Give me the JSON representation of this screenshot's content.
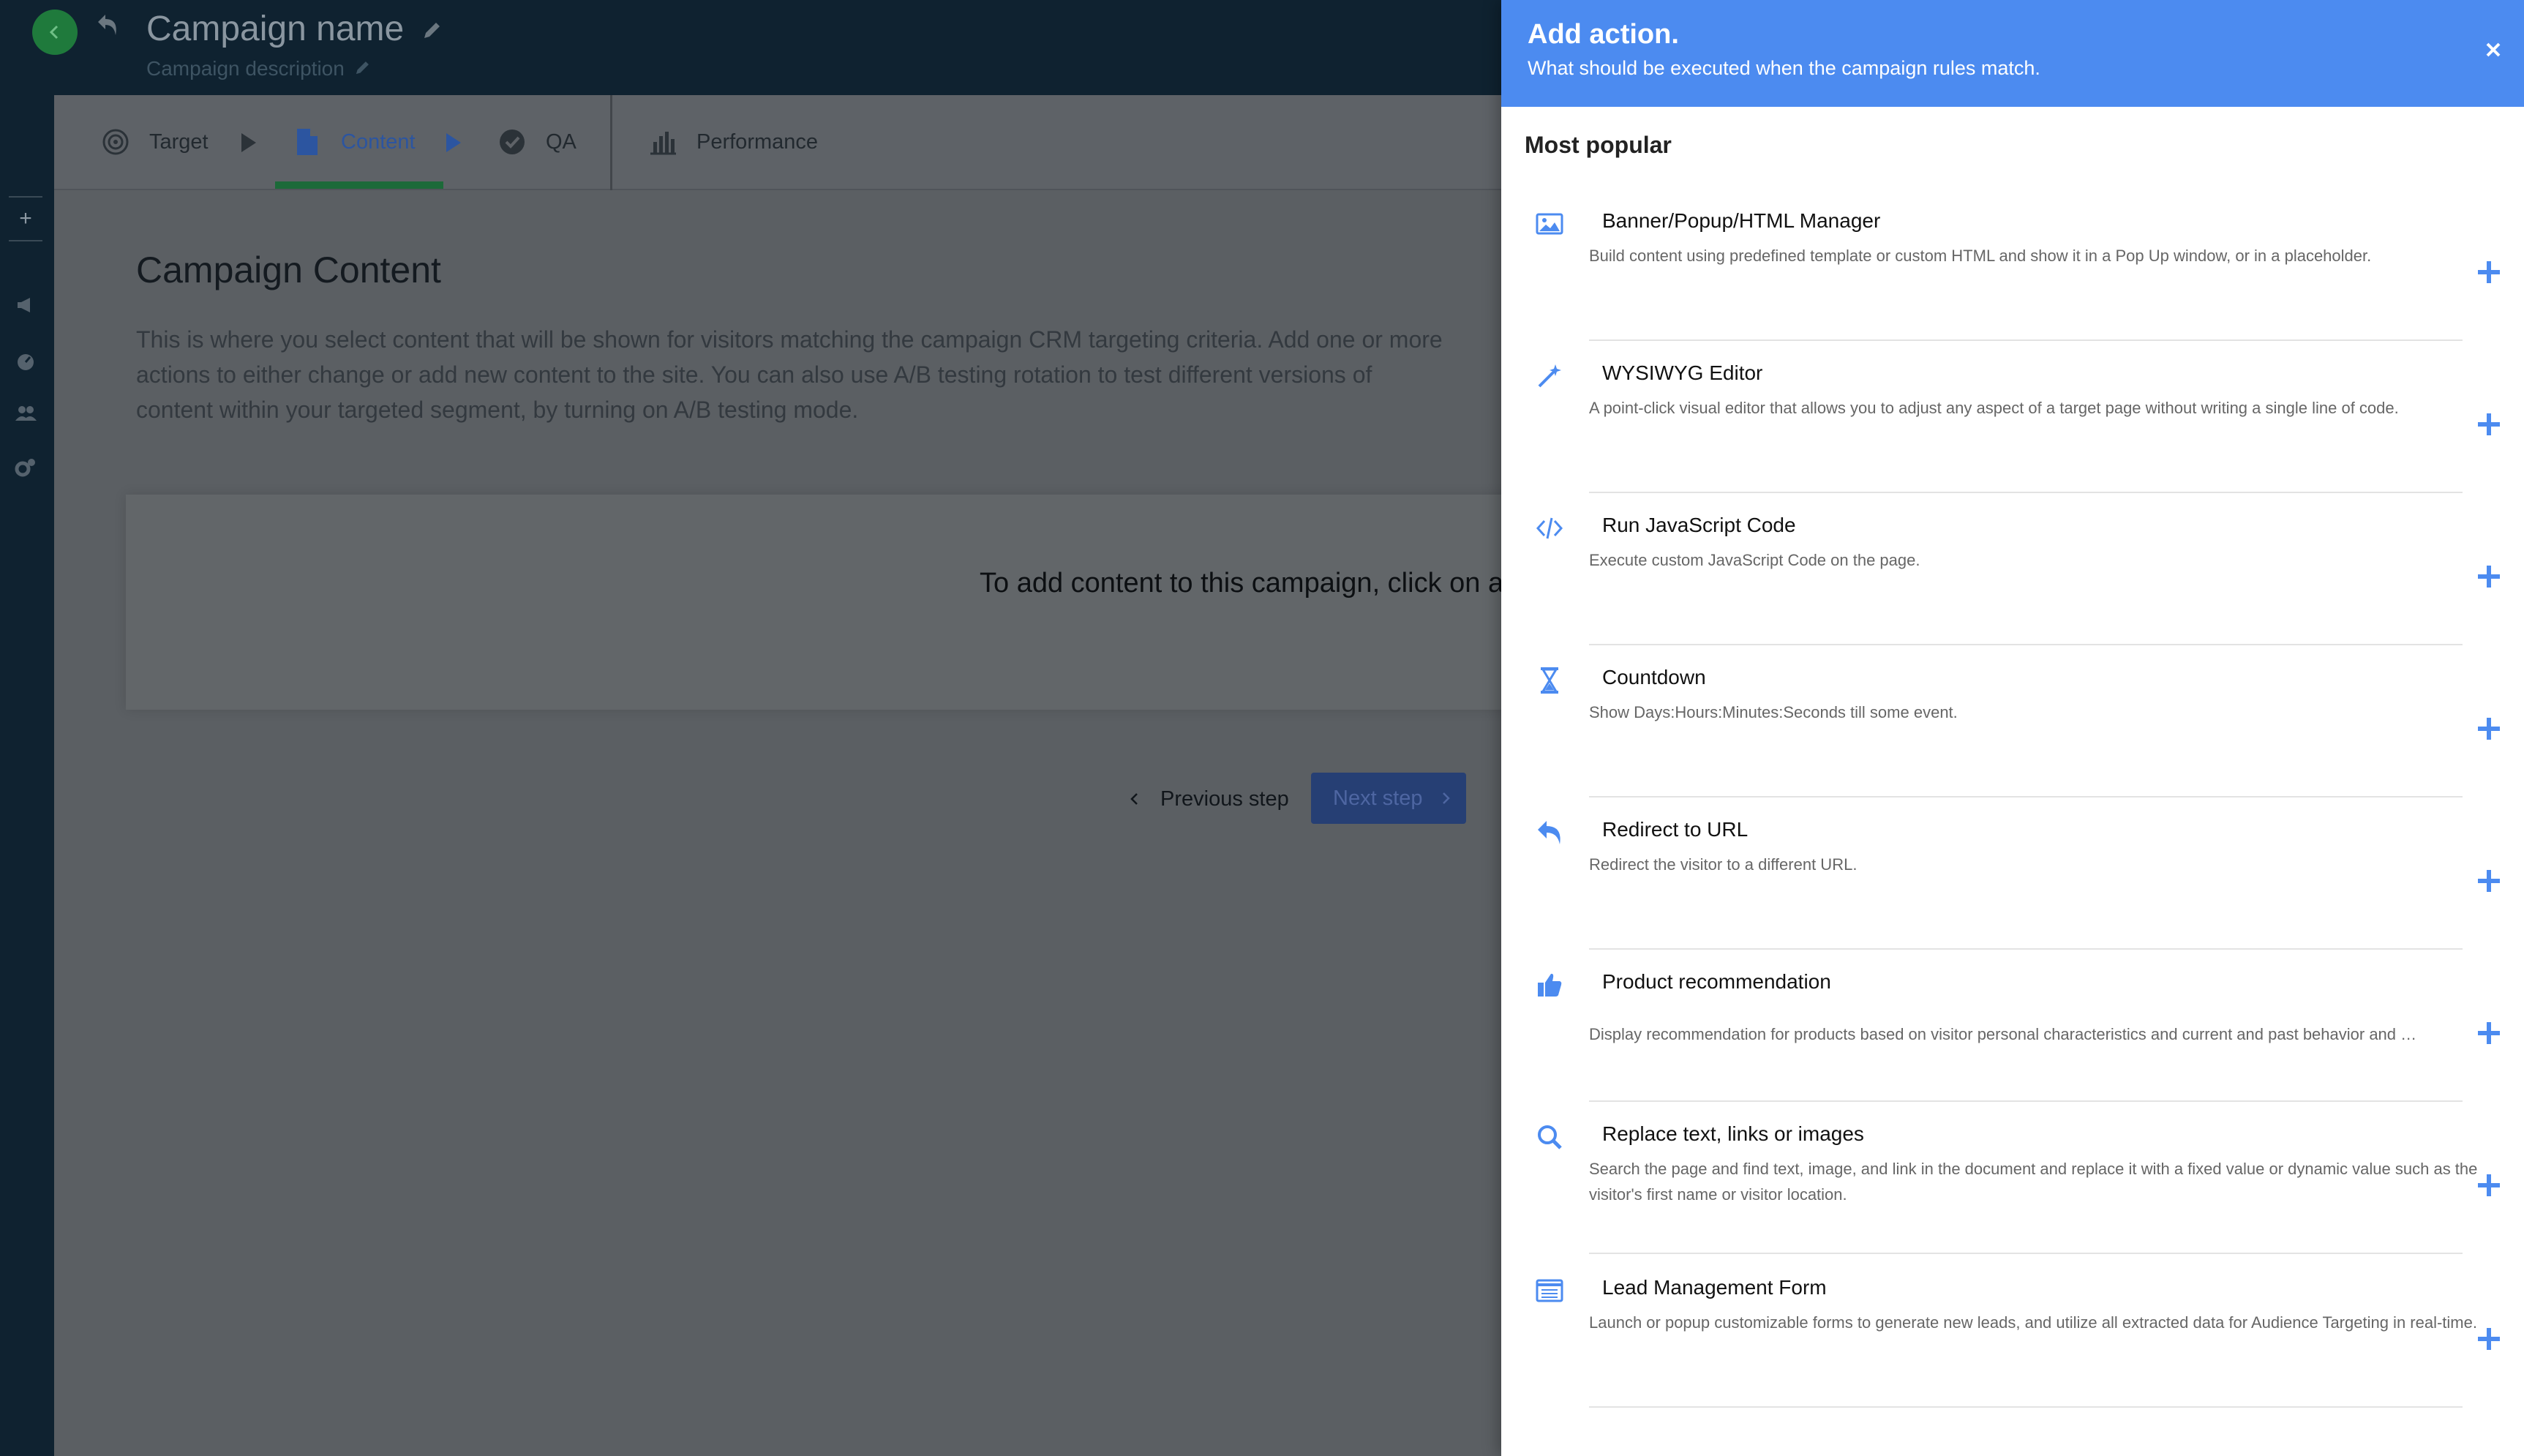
{
  "colors": {
    "accent_blue": "#4c8bf0",
    "rail_dark": "#0f2230",
    "green_indicator": "#1c6a39",
    "overlay_gray": "#5b5f63"
  },
  "header": {
    "campaign_name": "Campaign name",
    "campaign_description": "Campaign description"
  },
  "tabs": [
    {
      "label": "Target",
      "icon": "target-icon"
    },
    {
      "label": "Content",
      "icon": "document-icon",
      "active": true
    },
    {
      "label": "QA",
      "icon": "check-circle-icon"
    },
    {
      "label": "Performance",
      "icon": "bar-chart-icon"
    }
  ],
  "main": {
    "heading": "Campaign Content",
    "paragraph": "This is where you select content that will be shown for visitors matching the campaign CRM targeting criteria. Add one or more actions to either change or add new content to the site. You can also use A/B testing rotation to test different versions of content within your targeted segment, by turning on A/B testing mode.",
    "empty_message": "To add content to this campaign, click on add",
    "prev_label": "Previous step",
    "next_label": "Next step"
  },
  "drawer": {
    "title": "Add action.",
    "subtitle": "What should be executed when the campaign rules match.",
    "section_title": "Most popular",
    "actions": [
      {
        "name": "Banner/Popup/HTML Manager",
        "description": "Build content using predefined template or custom HTML and show it in a Pop Up window, or in a placeholder.",
        "icon": "image-icon"
      },
      {
        "name": "WYSIWYG Editor",
        "description": "A point-click visual editor that allows you to adjust any aspect of a target page without writing a single line of code.",
        "icon": "magic-wand-icon"
      },
      {
        "name": "Run JavaScript Code",
        "description": "Execute custom JavaScript Code on the page.",
        "icon": "code-icon"
      },
      {
        "name": "Countdown",
        "description": "Show Days:Hours:Minutes:Seconds till some event.",
        "icon": "hourglass-icon"
      },
      {
        "name": "Redirect to URL",
        "description": "Redirect the visitor to a different URL.",
        "icon": "reply-arrow-icon"
      },
      {
        "name": "Product recommendation",
        "description": "Display recommendation for products based on visitor personal characteristics and current and past behavior and …",
        "icon": "thumbs-up-icon"
      },
      {
        "name": "Replace text, links or images",
        "description": "Search the page and find text, image, and link in the document and replace it with a fixed value or dynamic value such as the visitor's first name or visitor location.",
        "icon": "search-icon"
      },
      {
        "name": "Lead Management Form",
        "description": "Launch or popup customizable forms to generate new leads, and utilize all extracted data for Audience Targeting in real-time.",
        "icon": "form-list-icon"
      }
    ]
  }
}
